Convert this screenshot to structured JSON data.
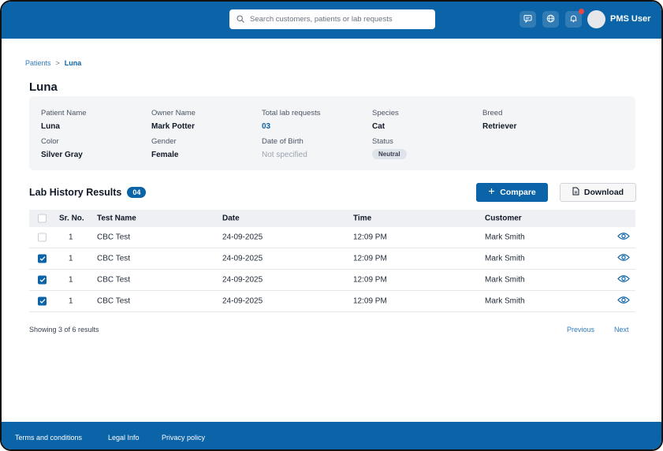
{
  "header": {
    "search_placeholder": "Search customers, patients or lab requests",
    "user_name": "PMS User"
  },
  "breadcrumb": {
    "parent": "Patients",
    "separator": ">",
    "current": "Luna"
  },
  "page_title": "Luna",
  "patient": {
    "fields": [
      {
        "label": "Patient Name",
        "value": "Luna"
      },
      {
        "label": "Owner Name",
        "value": "Mark Potter"
      },
      {
        "label": "Total lab requests",
        "value": "03"
      },
      {
        "label": "Species",
        "value": "Cat"
      },
      {
        "label": "Breed",
        "value": "Retriever"
      },
      {
        "label": "Color",
        "value": "Silver Gray"
      },
      {
        "label": "Gender",
        "value": "Female"
      },
      {
        "label": "Date of Birth",
        "value": "Not specified"
      },
      {
        "label": "Status",
        "value": "Neutral"
      }
    ]
  },
  "lab_history": {
    "title": "Lab History Results",
    "count": "04",
    "compare_label": "Compare",
    "download_label": "Download",
    "columns": [
      "Sr. No.",
      "Test Name",
      "Date",
      "Time",
      "Customer"
    ],
    "rows": [
      {
        "checked": false,
        "sr": "1",
        "test": "CBC Test",
        "date": "24-09-2025",
        "time": "12:09 PM",
        "customer": "Mark Smith"
      },
      {
        "checked": true,
        "sr": "1",
        "test": "CBC Test",
        "date": "24-09-2025",
        "time": "12:09 PM",
        "customer": "Mark Smith"
      },
      {
        "checked": true,
        "sr": "1",
        "test": "CBC Test",
        "date": "24-09-2025",
        "time": "12:09 PM",
        "customer": "Mark Smith"
      },
      {
        "checked": true,
        "sr": "1",
        "test": "CBC Test",
        "date": "24-09-2025",
        "time": "12:09 PM",
        "customer": "Mark Smith"
      }
    ],
    "showing": "Showing 3 of 6 results",
    "previous_label": "Previous",
    "next_label": "Next"
  },
  "footer": {
    "links": [
      "Terms and conditions",
      "Legal Info",
      "Privacy policy"
    ]
  },
  "colors": {
    "brand": "#0b63a8",
    "notification": "#ef4444"
  },
  "icons": {
    "search": "search-icon",
    "chat": "chat-icon",
    "globe": "globe-icon",
    "bell": "bell-icon",
    "plus": "plus-icon",
    "file": "file-icon",
    "eye": "eye-icon"
  }
}
